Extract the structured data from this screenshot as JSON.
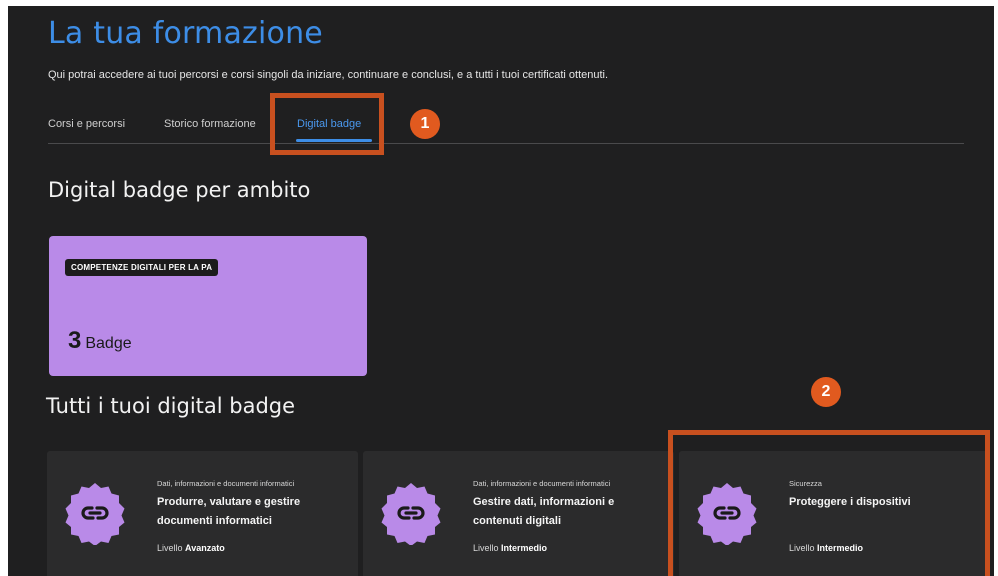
{
  "header": {
    "title": "La tua formazione",
    "subtitle": "Qui potrai accedere ai tuoi percorsi e corsi singoli da iniziare, continuare e conclusi, e a tutti i tuoi certificati ottenuti."
  },
  "tabs": [
    {
      "label": "Corsi e percorsi",
      "active": false
    },
    {
      "label": "Storico formazione",
      "active": false
    },
    {
      "label": "Digital badge",
      "active": true
    }
  ],
  "annotations": {
    "step1": "1",
    "step2": "2"
  },
  "section_by_area": {
    "title": "Digital badge per ambito",
    "card": {
      "chip": "COMPETENZE DIGITALI PER LA PA",
      "count": "3",
      "count_label": "Badge"
    }
  },
  "section_all": {
    "title": "Tutti i tuoi digital badge",
    "badges": [
      {
        "domain": "Dati, informazioni e documenti informatici",
        "name": "Produrre, valutare e gestire documenti informatici",
        "level_label": "Livello",
        "level": "Avanzato"
      },
      {
        "domain": "Dati, informazioni e documenti informatici",
        "name": "Gestire dati, informazioni e contenuti digitali",
        "level_label": "Livello",
        "level": "Intermedio"
      },
      {
        "domain": "Sicurezza",
        "name": "Proteggere i dispositivi",
        "level_label": "Livello",
        "level": "Intermedio"
      }
    ]
  },
  "colors": {
    "background": "#1f1f20",
    "accent": "#3d8de6",
    "card_purple": "#b98ae8",
    "highlight": "#c8501f",
    "step_badge": "#e15a1f"
  },
  "icons": {
    "badge_seal": "link-badge-icon"
  }
}
